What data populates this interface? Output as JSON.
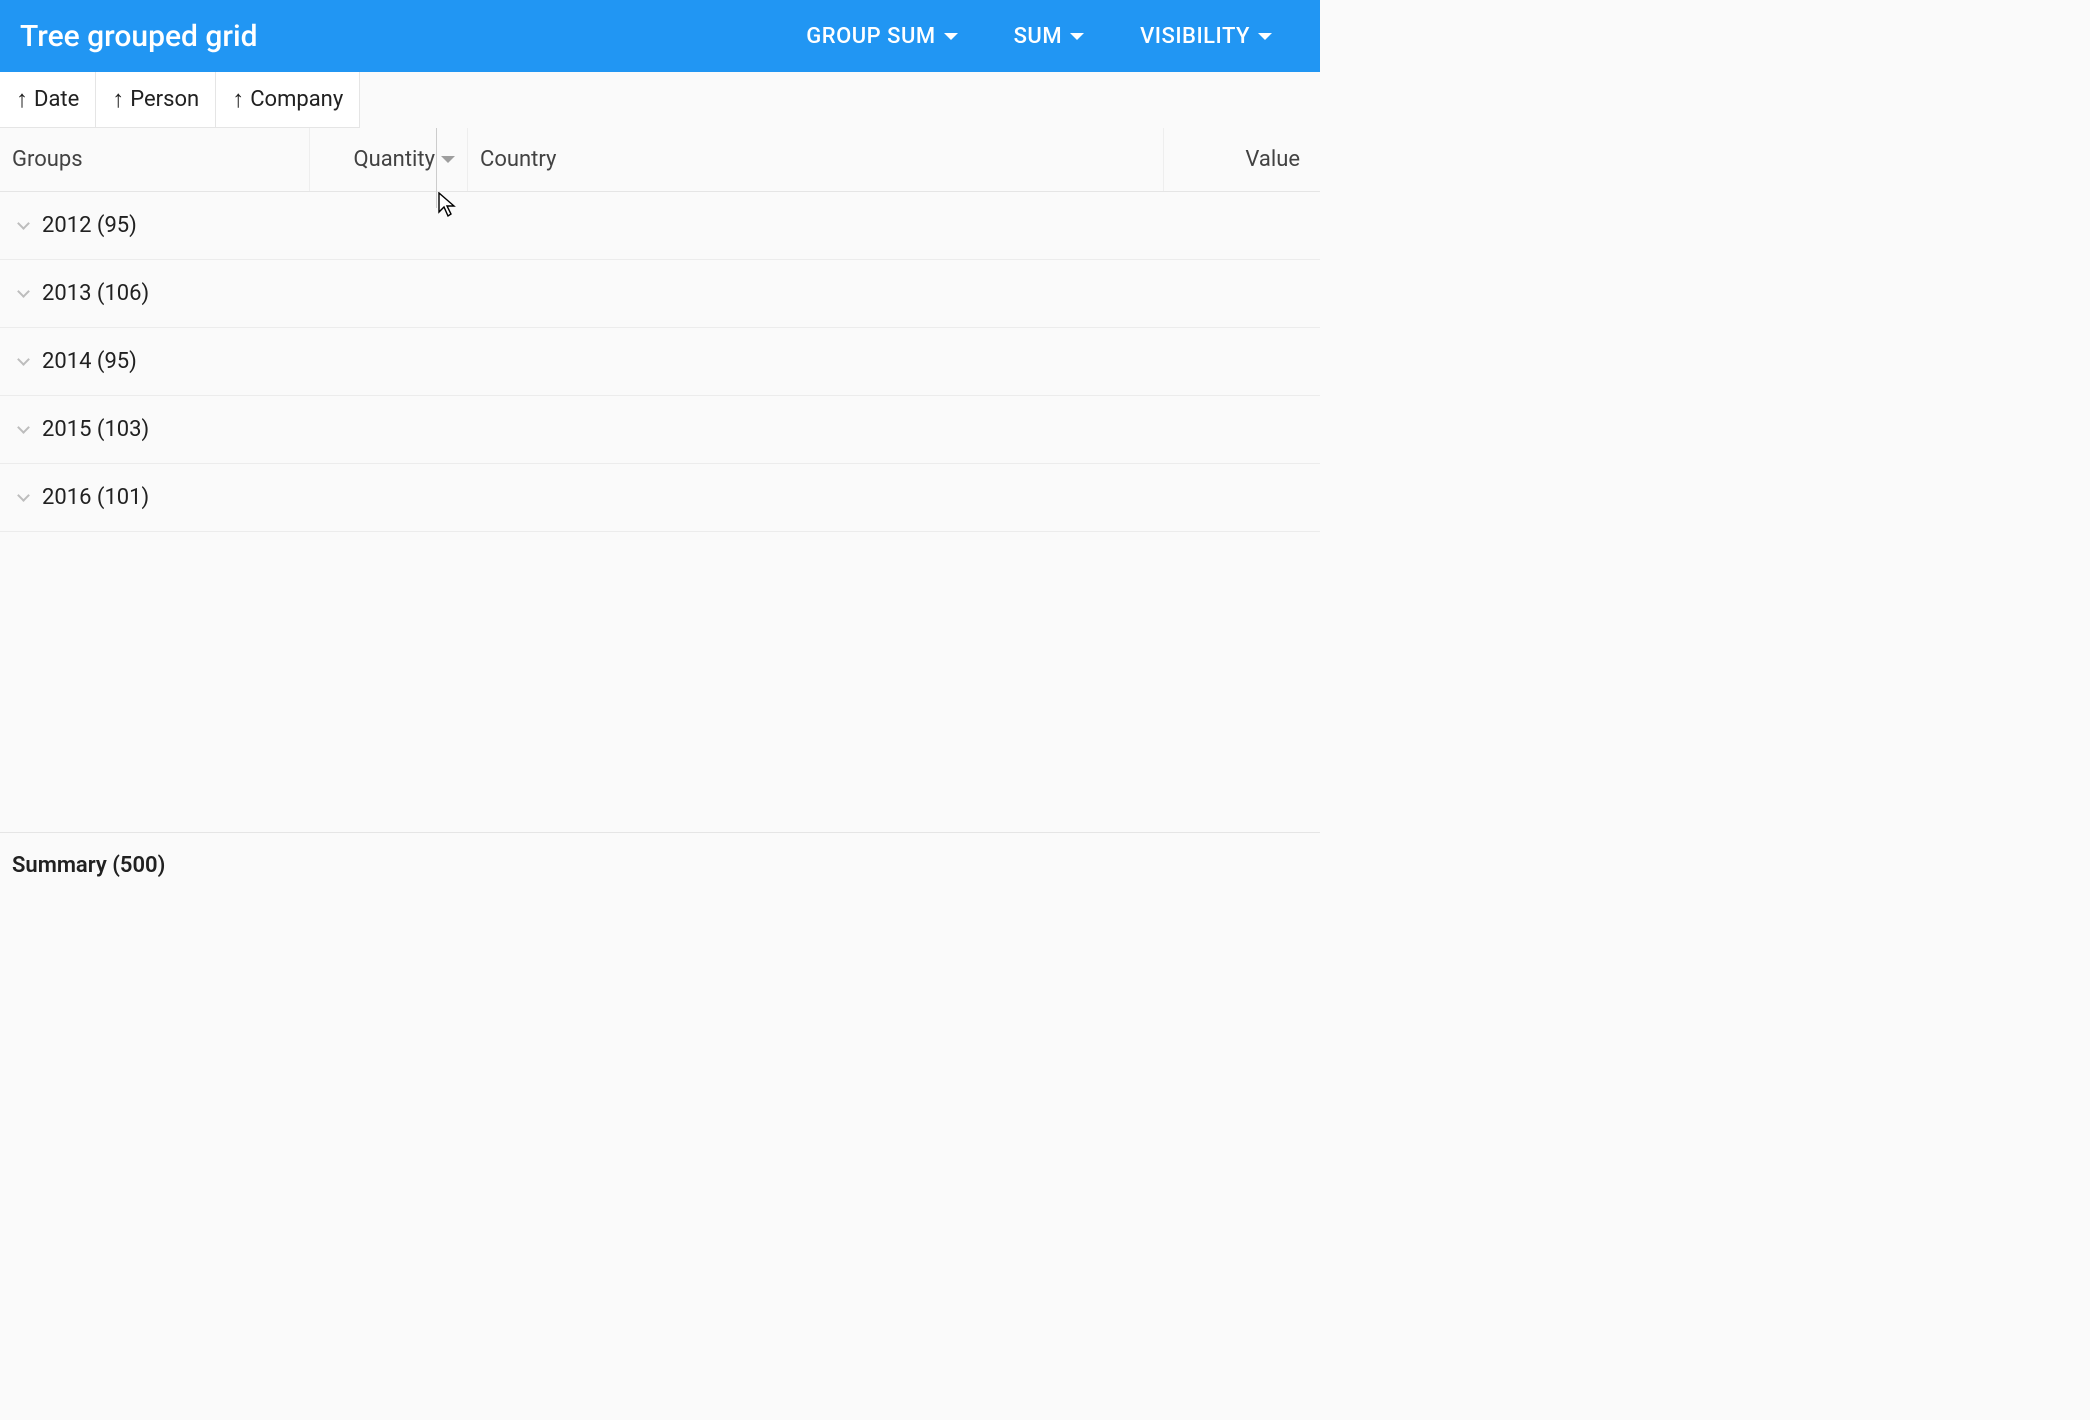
{
  "titlebar": {
    "title": "Tree grouped grid",
    "buttons": [
      {
        "label": "GROUP SUM"
      },
      {
        "label": "SUM"
      },
      {
        "label": "VISIBILITY"
      }
    ]
  },
  "group_by": [
    {
      "label": "Date",
      "dir": "asc"
    },
    {
      "label": "Person",
      "dir": "asc"
    },
    {
      "label": "Company",
      "dir": "asc"
    }
  ],
  "columns": {
    "groups": "Groups",
    "quantity": "Quantity",
    "country": "Country",
    "value": "Value"
  },
  "rows": [
    {
      "label": "2012 (95)"
    },
    {
      "label": "2013 (106)"
    },
    {
      "label": "2014 (95)"
    },
    {
      "label": "2015 (103)"
    },
    {
      "label": "2016 (101)"
    }
  ],
  "summary": {
    "label": "Summary (500)"
  }
}
